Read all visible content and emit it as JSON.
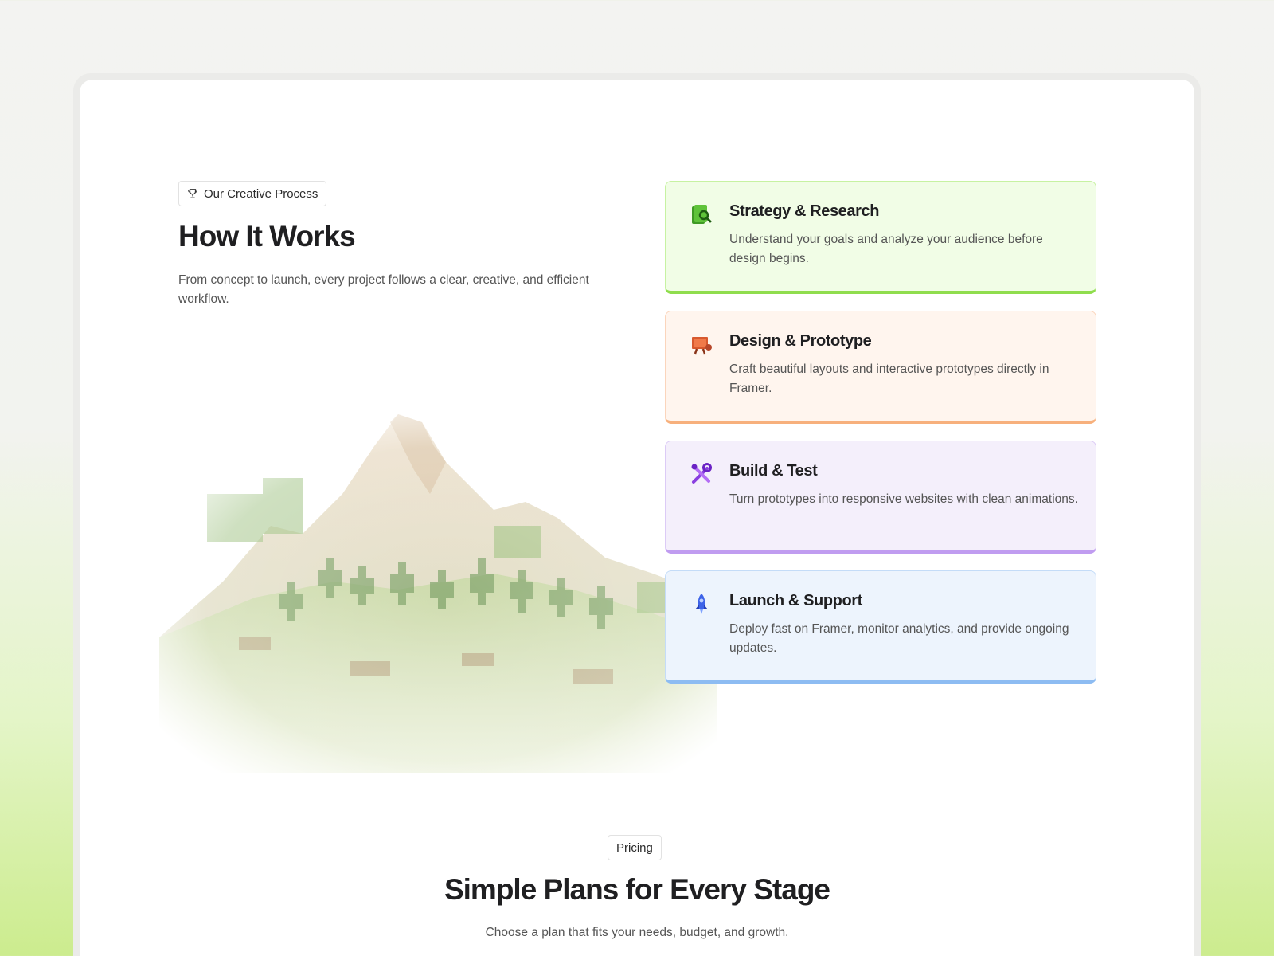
{
  "process": {
    "badge_icon": "trophy-icon",
    "badge_label": "Our Creative Process",
    "title": "How It Works",
    "subtitle": "From concept to launch, every project follows a clear, creative, and efficient workflow."
  },
  "steps": [
    {
      "title": "Strategy & Research",
      "description": "Understand your goals and analyze your audience before design begins.",
      "icon": "research-book-icon",
      "accent": "#8fdd4d"
    },
    {
      "title": "Design & Prototype",
      "description": "Craft beautiful layouts and interactive prototypes directly in Framer.",
      "icon": "design-board-icon",
      "accent": "#f7b07c"
    },
    {
      "title": "Build & Test",
      "description": "Turn prototypes into responsive websites with clean animations.",
      "icon": "tools-icon",
      "accent": "#c09cf0"
    },
    {
      "title": "Launch & Support",
      "description": "Deploy fast on Framer, monitor analytics, and provide ongoing updates.",
      "icon": "rocket-icon",
      "accent": "#8dbcf2"
    }
  ],
  "pricing": {
    "badge_label": "Pricing",
    "title": "Simple Plans for Every Stage",
    "subtitle": "Choose a plan that fits your needs, budget, and growth."
  }
}
